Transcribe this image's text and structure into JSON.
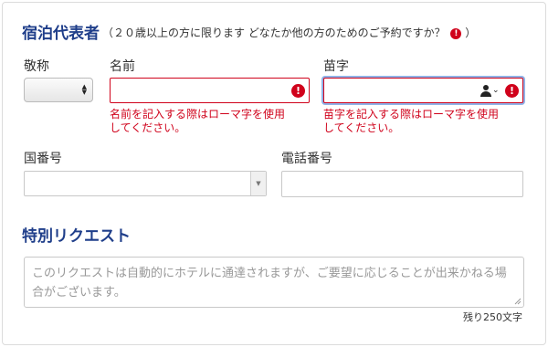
{
  "guest_section": {
    "title": "宿泊代表者",
    "subtitle": "（２０歳以上の方に限ります どなたか他の方のためのご予約ですか？",
    "subtitle_close": "）",
    "info_icon": "!"
  },
  "fields": {
    "honorific_label": "敬称",
    "first_name_label": "名前",
    "last_name_label": "苗字",
    "first_name_error_line1": "名前を記入する際はローマ字を使用",
    "first_name_error_line2": "してください。",
    "last_name_error_line1": "苗字を記入する際はローマ字を使用",
    "last_name_error_line2": "してください。",
    "country_code_label": "国番号",
    "phone_label": "電話番号",
    "error_icon": "!"
  },
  "special_request": {
    "title": "特別リクエスト",
    "placeholder_line1": "このリクエストは自動的にホテルに通達されますが、ご要望に応じることが出来かねる場",
    "placeholder_line2": "合がございます。",
    "counter": "残り250文字"
  },
  "colors": {
    "heading": "#1f3e8a",
    "error": "#d0021b",
    "focus_ring": "#8fb3e8"
  },
  "icons": [
    "info-icon",
    "error-icon",
    "contact-person-icon",
    "select-updown-icon",
    "dropdown-arrow-icon",
    "resize-grip-icon"
  ]
}
